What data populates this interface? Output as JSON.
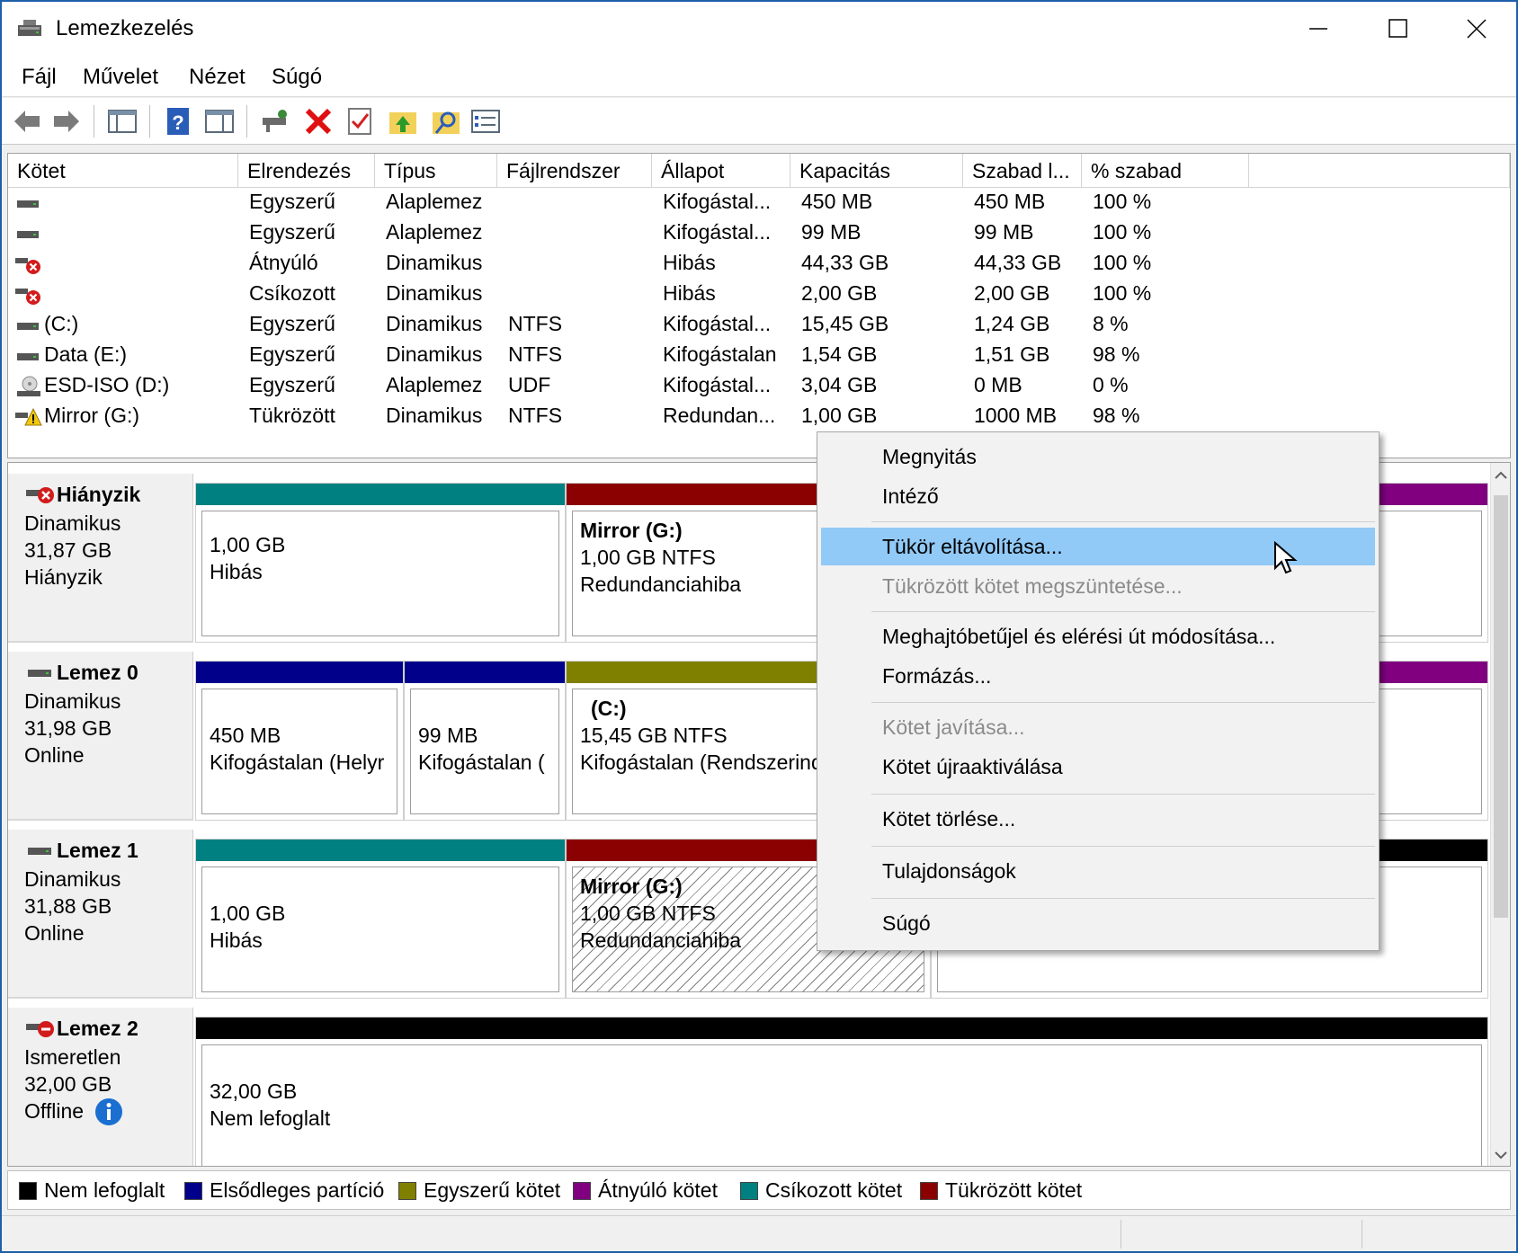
{
  "window": {
    "title": "Lemezkezelés"
  },
  "menu": [
    "Fájl",
    "Művelet",
    "Nézet",
    "Súgó"
  ],
  "toolbar_icons": [
    "back-arrow-icon",
    "forward-arrow-icon",
    "console-tree-icon",
    "help-icon",
    "properties-icon",
    "connect-icon",
    "delete-icon",
    "check-icon",
    "up-folder-icon",
    "search-folder-icon",
    "options-icon"
  ],
  "columns": [
    "Kötet",
    "Elrendezés",
    "Típus",
    "Fájlrendszer",
    "Állapot",
    "Kapacitás",
    "Szabad l...",
    "% szabad"
  ],
  "volumes": [
    {
      "icon": "drive-icon",
      "name": "",
      "layout": "Egyszerű",
      "type": "Alaplemez",
      "fs": "",
      "status": "Kifogástal...",
      "capacity": "450 MB",
      "free": "450 MB",
      "pct": "100 %"
    },
    {
      "icon": "drive-icon",
      "name": "",
      "layout": "Egyszerű",
      "type": "Alaplemez",
      "fs": "",
      "status": "Kifogástal...",
      "capacity": "99 MB",
      "free": "99 MB",
      "pct": "100 %"
    },
    {
      "icon": "drive-error-icon",
      "name": "",
      "layout": "Átnyúló",
      "type": "Dinamikus",
      "fs": "",
      "status": "Hibás",
      "capacity": "44,33 GB",
      "free": "44,33 GB",
      "pct": "100 %"
    },
    {
      "icon": "drive-error-icon",
      "name": "",
      "layout": "Csíkozott",
      "type": "Dinamikus",
      "fs": "",
      "status": "Hibás",
      "capacity": "2,00 GB",
      "free": "2,00 GB",
      "pct": "100 %"
    },
    {
      "icon": "drive-icon",
      "name": "(C:)",
      "layout": "Egyszerű",
      "type": "Dinamikus",
      "fs": "NTFS",
      "status": "Kifogástal...",
      "capacity": "15,45 GB",
      "free": "1,24 GB",
      "pct": "8 %"
    },
    {
      "icon": "drive-icon",
      "name": "Data (E:)",
      "layout": "Egyszerű",
      "type": "Dinamikus",
      "fs": "NTFS",
      "status": "Kifogástalan",
      "capacity": "1,54 GB",
      "free": "1,51 GB",
      "pct": "98 %"
    },
    {
      "icon": "cd-drive-icon",
      "name": "ESD-ISO (D:)",
      "layout": "Egyszerű",
      "type": "Alaplemez",
      "fs": "UDF",
      "status": "Kifogástal...",
      "capacity": "3,04 GB",
      "free": "0 MB",
      "pct": "0 %"
    },
    {
      "icon": "drive-warning-icon",
      "name": "Mirror (G:)",
      "layout": "Tükrözött",
      "type": "Dinamikus",
      "fs": "NTFS",
      "status": "Redundan...",
      "capacity": "1,00 GB",
      "free": "1000 MB",
      "pct": "98 %"
    }
  ],
  "disks": [
    {
      "name": "Hiányzik",
      "kind": "Dinamikus",
      "size": "31,87 GB",
      "state": "Hiányzik",
      "parts": [
        {
          "title": "",
          "line1": "1,00 GB",
          "line2": "Hibás"
        },
        {
          "title": "Mirror  (G:)",
          "line1": "1,00 GB NTFS",
          "line2": "Redundanciahiba"
        }
      ]
    },
    {
      "name": "Lemez 0",
      "kind": "Dinamikus",
      "size": "31,98 GB",
      "state": "Online",
      "parts": [
        {
          "title": "",
          "line1": "450 MB",
          "line2": "Kifogástalan (Helyr"
        },
        {
          "title": "",
          "line1": "99 MB",
          "line2": "Kifogástalan ("
        },
        {
          "title": "(C:)",
          "line1": "15,45 GB NTFS",
          "line2": "Kifogástalan (Rendszerind"
        }
      ]
    },
    {
      "name": "Lemez 1",
      "kind": "Dinamikus",
      "size": "31,88 GB",
      "state": "Online",
      "parts": [
        {
          "title": "",
          "line1": "1,00 GB",
          "line2": "Hibás"
        },
        {
          "title": "Mirror  (G:)",
          "line1": "1,00 GB NTFS",
          "line2": "Redundanciahiba"
        }
      ]
    },
    {
      "name": "Lemez 2",
      "kind": "Ismeretlen",
      "size": "32,00 GB",
      "state": "Offline",
      "parts": [
        {
          "title": "",
          "line1": "32,00 GB",
          "line2": "Nem lefoglalt"
        }
      ]
    }
  ],
  "legend": [
    {
      "label": "Nem lefoglalt",
      "color": "#000000"
    },
    {
      "label": "Elsődleges partíció",
      "color": "#00008b"
    },
    {
      "label": "Egyszerű kötet",
      "color": "#808000"
    },
    {
      "label": "Átnyúló kötet",
      "color": "#800080"
    },
    {
      "label": "Csíkozott kötet",
      "color": "#008080"
    },
    {
      "label": "Tükrözött kötet",
      "color": "#8b0000"
    }
  ],
  "context_menu": [
    {
      "label": "Megnyitás",
      "state": "normal"
    },
    {
      "label": "Intéző",
      "state": "normal"
    },
    {
      "label": "Tükör eltávolítása...",
      "state": "highlighted"
    },
    {
      "label": "Tükrözött kötet megszüntetése...",
      "state": "disabled"
    },
    {
      "label": "Meghajtóbetűjel és elérési út módosítása...",
      "state": "normal"
    },
    {
      "label": "Formázás...",
      "state": "normal"
    },
    {
      "label": "Kötet javítása...",
      "state": "disabled"
    },
    {
      "label": "Kötet újraaktiválása",
      "state": "normal"
    },
    {
      "label": "Kötet törlése...",
      "state": "normal"
    },
    {
      "label": "Tulajdonságok",
      "state": "normal"
    },
    {
      "label": "Súgó",
      "state": "normal"
    }
  ]
}
